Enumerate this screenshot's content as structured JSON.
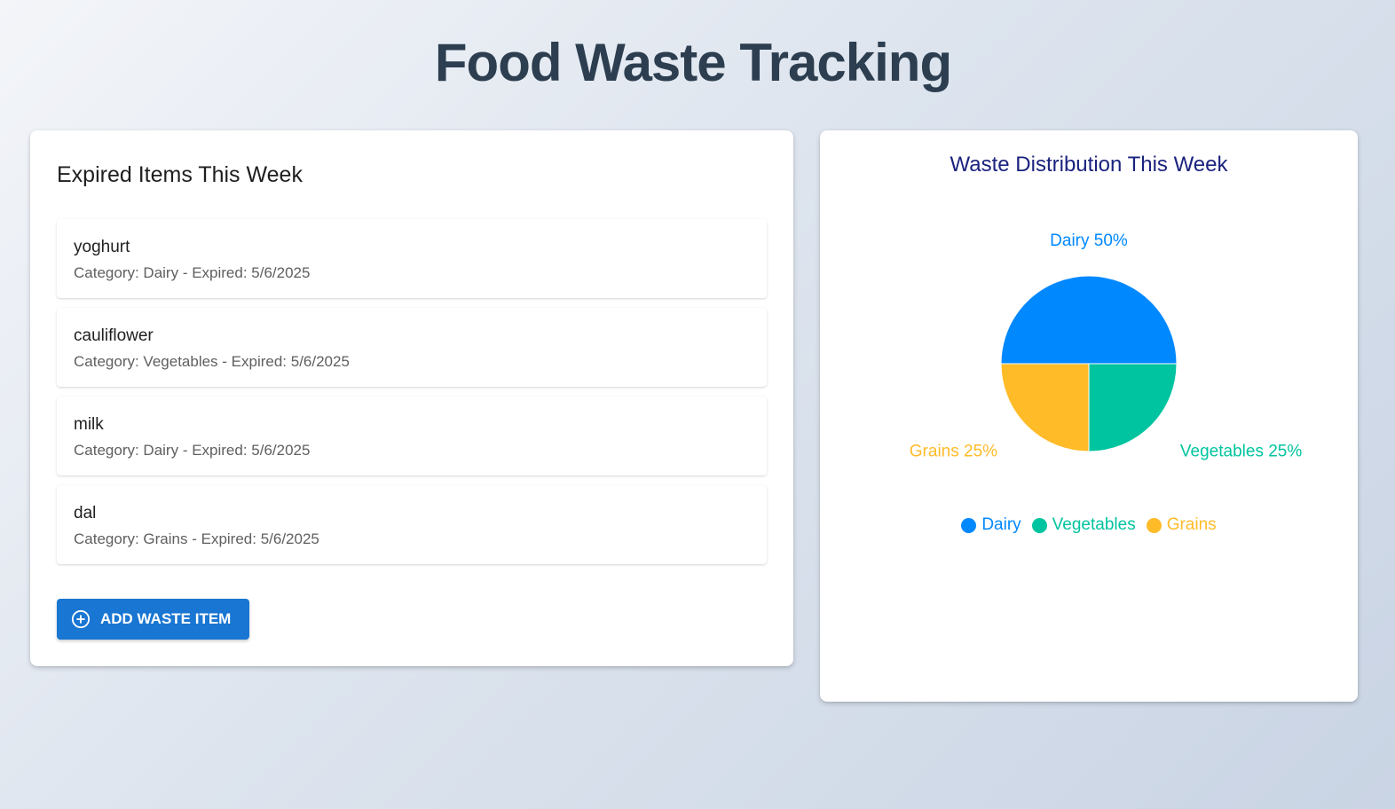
{
  "page": {
    "title": "Food Waste Tracking"
  },
  "expired": {
    "heading": "Expired Items This Week",
    "items": [
      {
        "name": "yoghurt",
        "meta": "Category: Dairy - Expired: 5/6/2025"
      },
      {
        "name": "cauliflower",
        "meta": "Category: Vegetables - Expired: 5/6/2025"
      },
      {
        "name": "milk",
        "meta": "Category: Dairy - Expired: 5/6/2025"
      },
      {
        "name": "dal",
        "meta": "Category: Grains - Expired: 5/6/2025"
      }
    ],
    "add_button_label": "ADD WASTE ITEM",
    "add_button_icon": "add-circle-icon"
  },
  "chart": {
    "title": "Waste Distribution This Week"
  },
  "chart_data": {
    "type": "pie",
    "title": "Waste Distribution This Week",
    "categories": [
      "Dairy",
      "Vegetables",
      "Grains"
    ],
    "values": [
      50,
      25,
      25
    ],
    "slice_labels": [
      "Dairy 50%",
      "Vegetables 25%",
      "Grains 25%"
    ],
    "colors": [
      "#0088fe",
      "#00c49f",
      "#ffbb28"
    ],
    "legend": {
      "position": "bottom",
      "entries": [
        "Dairy",
        "Vegetables",
        "Grains"
      ]
    }
  },
  "colors": {
    "primary_button": "#1976d2",
    "page_title": "#2c3e50",
    "chart_title": "#1a237e"
  }
}
